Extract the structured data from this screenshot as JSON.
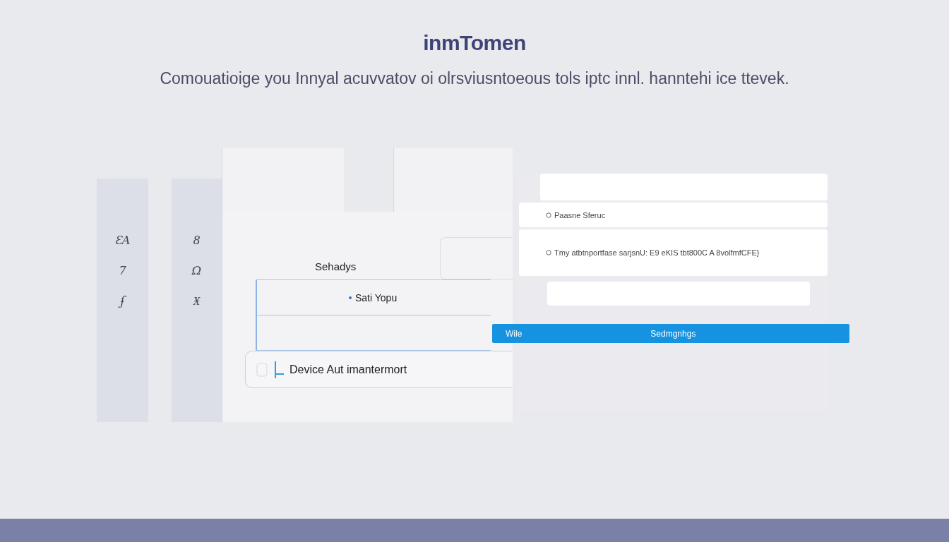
{
  "logo": "inmTomen",
  "tagline": "Comouatioige you Innyal acuvvatov oi olrsviusntoeous tols iptc innl. hanntehi ice ttevek.",
  "left_panel": {
    "sidebar_columns": [
      {
        "glyphs": [
          "ƐA",
          "7",
          "ʄ"
        ]
      },
      {
        "glyphs": [
          "8",
          "Ω",
          "Ӿ"
        ]
      }
    ],
    "section_label": "Sehadys",
    "list_item": "Sati Yopu",
    "device_card": "Device Aut imantermort"
  },
  "right_panel": {
    "info_rows": [
      "Paasne Sferuc",
      "Tmy atbtnportfase sarjsnU: E9 eKIS tbt800C A 8volfmfCFE}"
    ],
    "action_bar": {
      "left": "Wile",
      "right": "Sedmgnhgs"
    }
  }
}
